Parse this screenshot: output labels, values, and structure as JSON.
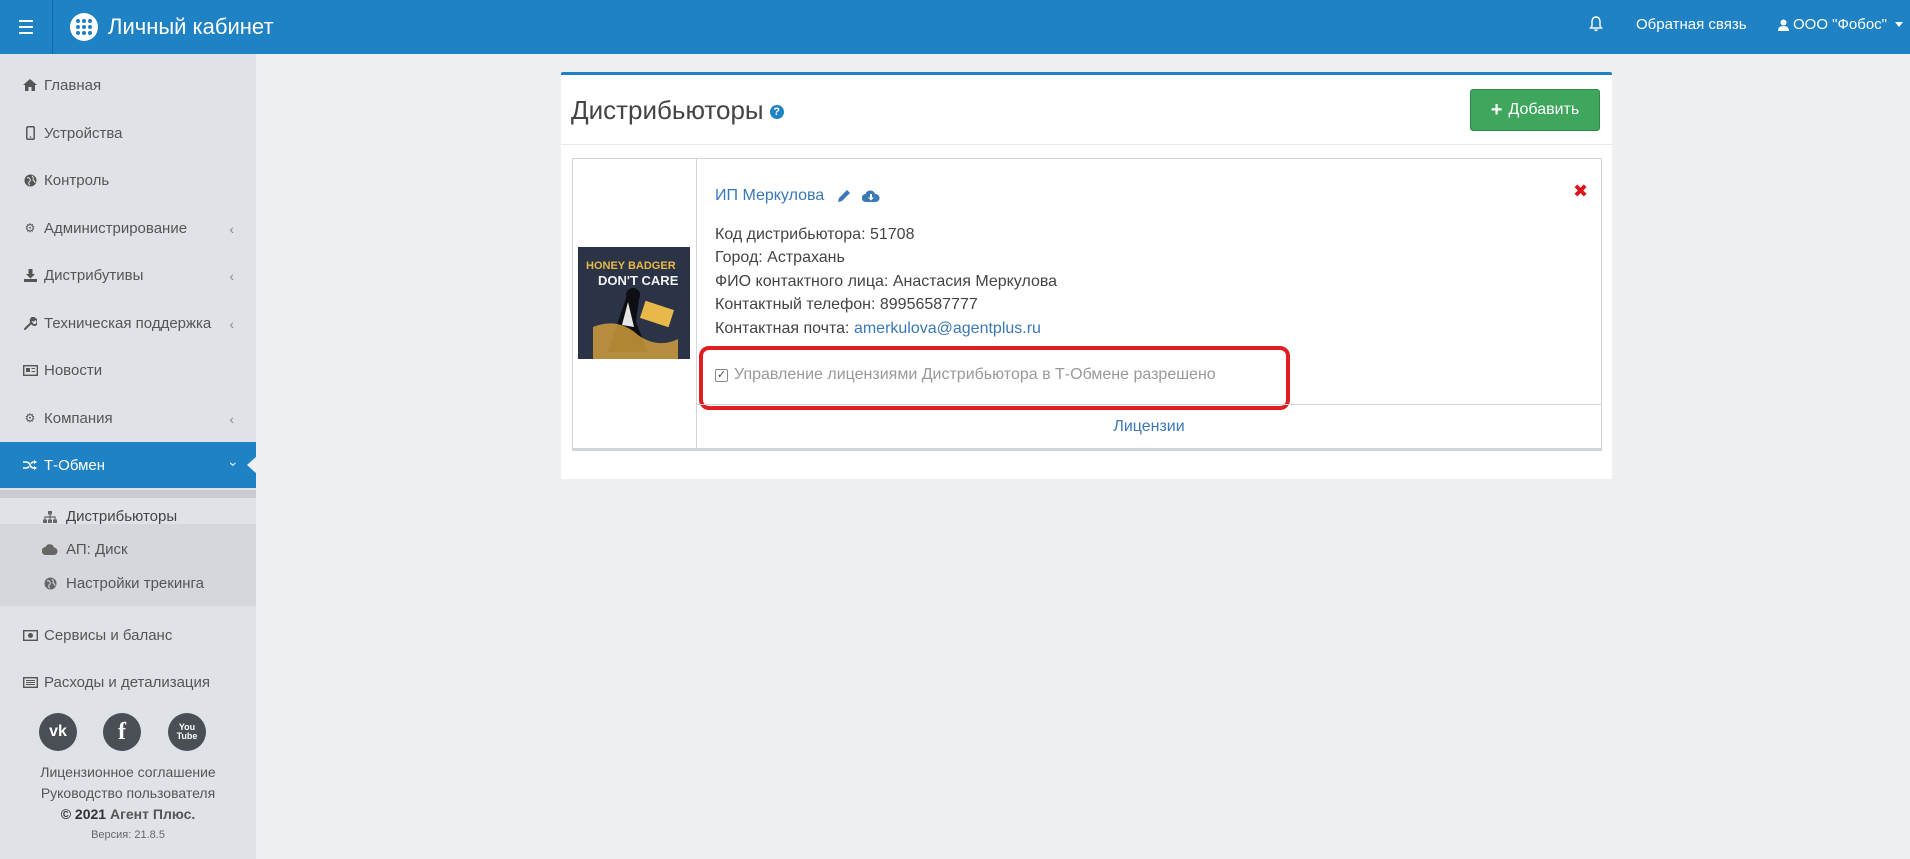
{
  "header": {
    "title": "Личный кабинет",
    "feedback": "Обратная связь",
    "user": "ООО \"Фобос\""
  },
  "sidebar": {
    "items": [
      {
        "label": "Главная",
        "icon": "home-icon"
      },
      {
        "label": "Устройства",
        "icon": "mobile-icon"
      },
      {
        "label": "Контроль",
        "icon": "globe-icon"
      },
      {
        "label": "Администрирование",
        "icon": "cogs-icon"
      },
      {
        "label": "Дистрибутивы",
        "icon": "download-icon"
      },
      {
        "label": "Техническая поддержка",
        "icon": "wrench-icon"
      },
      {
        "label": "Новости",
        "icon": "newspaper-icon"
      },
      {
        "label": "Компания",
        "icon": "gear-icon"
      },
      {
        "label": "Т-Обмен",
        "icon": "shuffle-icon"
      },
      {
        "label": "Сервисы и баланс",
        "icon": "money-icon"
      },
      {
        "label": "Расходы и детализация",
        "icon": "list-icon"
      }
    ],
    "submenu": [
      {
        "label": "Дистрибьюторы",
        "icon": "sitemap-icon"
      },
      {
        "label": "АП: Диск",
        "icon": "cloud-icon"
      },
      {
        "label": "Настройки трекинга",
        "icon": "globe-icon"
      }
    ],
    "footer": {
      "license": "Лицензионное соглашение",
      "manual": "Руководство пользователя",
      "copyright": "© 2021",
      "brand": "Агент Плюс.",
      "version": "Версия: 21.8.5"
    }
  },
  "main": {
    "title": "Дистрибьюторы",
    "add_button": "Добавить",
    "card": {
      "name": "ИП Меркулова",
      "code_label": "Код дистрибьютора: 51708",
      "city_label": "Город: Астрахань",
      "contact_label": "ФИО контактного лица: Анастасия Меркулова",
      "phone_label": "Контактный телефон: 89956587777",
      "email_prefix": "Контактная почта: ",
      "email": "amerkulova@agentplus.ru",
      "permission": "Управление лицензиями Дистрибьютора в Т-Обмене разрешено",
      "licenses_link": "Лицензии",
      "thumb_text_1": "HONEY BADGER",
      "thumb_text_2": "DON'T CARE"
    }
  },
  "colors": {
    "accent": "#1e82c4",
    "success": "#3ea65d",
    "danger": "#e01e22",
    "link": "#3a78b8"
  }
}
